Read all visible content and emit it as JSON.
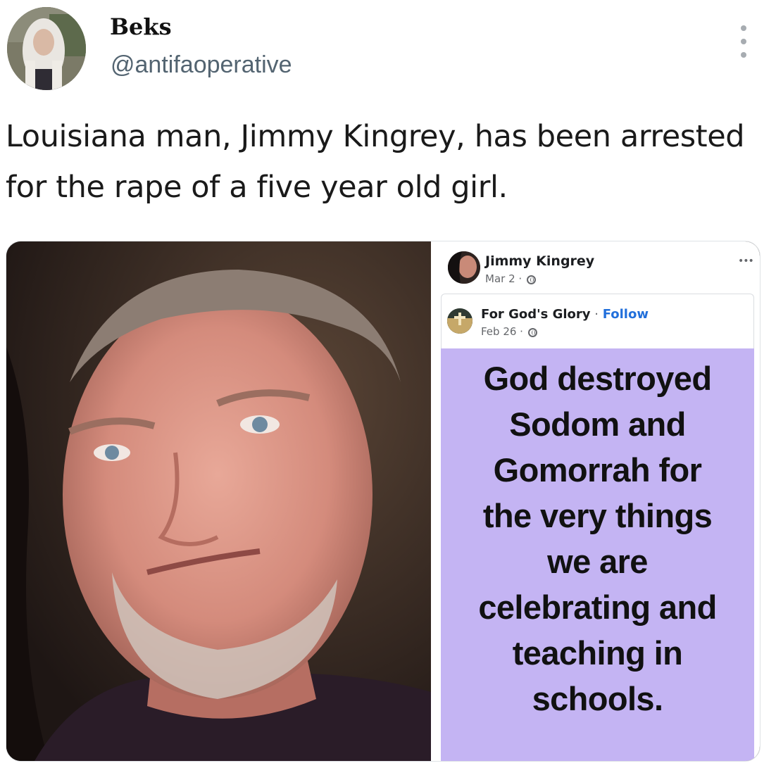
{
  "tweet": {
    "author": {
      "display_name": "Beks",
      "handle": "@antifaoperative",
      "avatar_icon": "profile-photo"
    },
    "more_icon": "more-options-icon",
    "text": "Louisiana man, Jimmy Kingrey, has been arrested for the rape of a five year old girl."
  },
  "media": {
    "facebook_post": {
      "author_name": "Jimmy Kingrey",
      "date": "Mar 2 ·",
      "more_label": "•••",
      "privacy_icon": "globe-icon",
      "shared_post": {
        "page_name": "For God's Glory",
        "separator": " · ",
        "follow_label": "Follow",
        "date": "Feb 26 ·",
        "privacy_icon": "globe-icon",
        "card_text": "God destroyed\nSodom and\nGomorrah for\nthe very things\nwe are\ncelebrating and\nteaching in\nschools.",
        "card_background": "#c4b4f3"
      }
    }
  },
  "colors": {
    "handle": "#536471",
    "follow_link": "#216fdb",
    "text": "#1a1a1a"
  }
}
